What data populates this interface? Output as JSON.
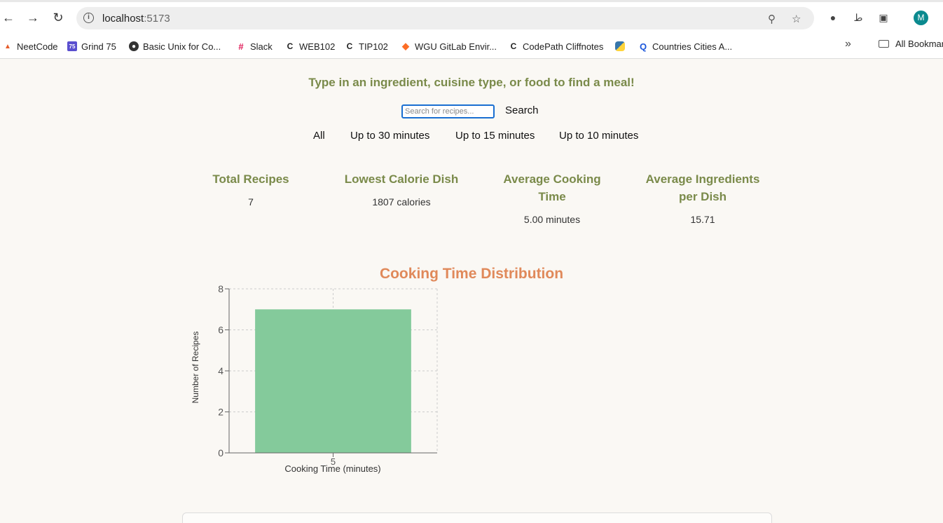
{
  "browser": {
    "url_host": "localhost",
    "url_port": ":5173",
    "avatar_letter": "M",
    "bookmarks": [
      {
        "label": "NeetCode",
        "icon": "neetcode-icon"
      },
      {
        "label": "Grind 75",
        "icon": "grind75-icon",
        "badge": "75"
      },
      {
        "label": "Basic Unix for Co...",
        "icon": "globe-icon"
      },
      {
        "label": "Slack",
        "icon": "slack-icon"
      },
      {
        "label": "WEB102",
        "icon": "codepath-icon",
        "badge": "C"
      },
      {
        "label": "TIP102",
        "icon": "codepath-icon",
        "badge": "C"
      },
      {
        "label": "WGU GitLab Envir...",
        "icon": "gitlab-icon"
      },
      {
        "label": "CodePath Cliffnotes",
        "icon": "codepath-icon",
        "badge": "C"
      },
      {
        "label": "",
        "icon": "python-icon"
      },
      {
        "label": "Countries Cities A...",
        "icon": "q-icon"
      }
    ],
    "all_bookmarks_label": "All Bookmar"
  },
  "page": {
    "tagline": "Type in an ingredient, cuisine type, or food to find a meal!",
    "search": {
      "placeholder": "Search for recipes...",
      "value": "",
      "button_label": "Search"
    },
    "filters": [
      "All",
      "Up to 30 minutes",
      "Up to 15 minutes",
      "Up to 10 minutes"
    ],
    "stats": [
      {
        "label": "Total Recipes",
        "value": "7"
      },
      {
        "label": "Lowest Calorie Dish",
        "value": "1807 calories"
      },
      {
        "label": "Average Cooking Time",
        "value": "5.00 minutes"
      },
      {
        "label": "Average Ingredients per Dish",
        "value": "15.71"
      }
    ],
    "chart_title": "Cooking Time Distribution"
  },
  "colors": {
    "accent_green": "#7a8a4a",
    "accent_orange": "#e0895a",
    "bar_fill": "#84ca9b"
  },
  "chart_data": {
    "type": "bar",
    "title": "Cooking Time Distribution",
    "xlabel": "Cooking Time (minutes)",
    "ylabel": "Number of Recipes",
    "categories": [
      "5"
    ],
    "values": [
      7
    ],
    "ylim": [
      0,
      8
    ],
    "yticks": [
      0,
      2,
      4,
      6,
      8
    ],
    "grid": true
  }
}
